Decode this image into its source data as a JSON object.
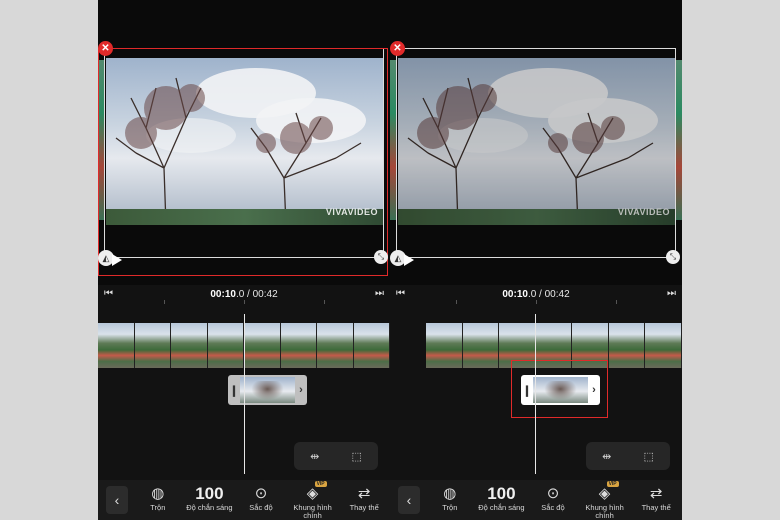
{
  "left": {
    "time_current": "00:10",
    "time_fraction": ".0",
    "time_total": " / 00:42",
    "watermark": "VIVAVIDEO"
  },
  "right": {
    "time_current": "00:10",
    "time_fraction": ".0",
    "time_total": " / 00:42",
    "watermark": "VIVAVIDEO"
  },
  "toolbar": {
    "blend_label": "Trộn",
    "brightness_value": "100",
    "brightness_label": "Độ chắn sáng",
    "hue_label": "Sắc độ",
    "keyframe_label": "Khung hình chính",
    "vip_badge": "VIP",
    "replace_label": "Thay thế"
  },
  "icons": {
    "close": "close-icon",
    "flip": "flip-icon",
    "scale": "scale-icon",
    "prev": "skip-start-icon",
    "next": "skip-end-icon",
    "split": "split-icon",
    "crop": "crop-icon",
    "back": "chevron-left-icon",
    "blend": "blend-icon",
    "hue": "hue-icon",
    "keyframe": "keyframe-icon",
    "replace": "replace-icon"
  },
  "colors": {
    "selection": "#e02a2a",
    "background": "#121212",
    "vip": "#d9a441"
  }
}
